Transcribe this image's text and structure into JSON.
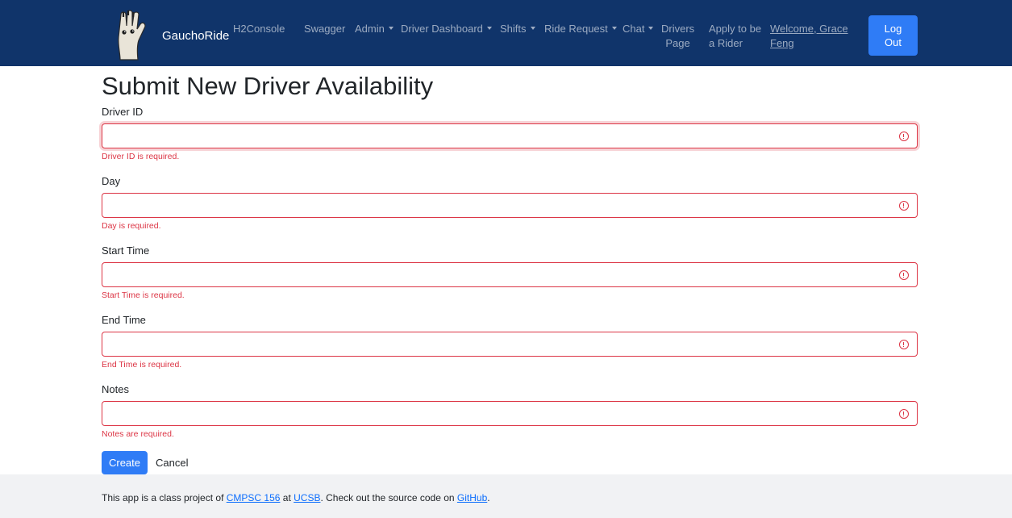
{
  "navbar": {
    "brand": "GauchoRide",
    "items": [
      {
        "label": "H2Console",
        "dropdown": false
      },
      {
        "label": "Swagger",
        "dropdown": false
      },
      {
        "label": "Admin",
        "dropdown": true
      },
      {
        "label": "Driver Dashboard",
        "dropdown": true
      },
      {
        "label": "Shifts",
        "dropdown": true
      },
      {
        "label": "Ride Request",
        "dropdown": true
      },
      {
        "label": "Chat",
        "dropdown": true
      }
    ],
    "drivers_page": {
      "line1": "Drivers",
      "line2": "Page"
    },
    "apply_rider": {
      "line1": "Apply to be",
      "line2": "a Rider"
    },
    "welcome": {
      "line1": "Welcome, Grace",
      "line2": "Feng"
    },
    "logout": {
      "line1": "Log",
      "line2": "Out"
    },
    "colors": {
      "background": "#10346a",
      "button": "#2f7cf6"
    }
  },
  "page": {
    "title": "Submit New Driver Availability"
  },
  "form": {
    "fields": [
      {
        "label": "Driver ID",
        "value": "",
        "error": "Driver ID is required."
      },
      {
        "label": "Day",
        "value": "",
        "error": "Day is required."
      },
      {
        "label": "Start Time",
        "value": "",
        "error": "Start Time is required."
      },
      {
        "label": "End Time",
        "value": "",
        "error": "End Time is required."
      },
      {
        "label": "Notes",
        "value": "",
        "error": "Notes are required."
      }
    ],
    "create_label": "Create",
    "cancel_label": "Cancel",
    "error_color": "#dc3545"
  },
  "footer": {
    "text_1": "This app is a class project of ",
    "link_1": "CMPSC 156",
    "text_2": " at ",
    "link_2": "UCSB",
    "text_3": ". Check out the source code on ",
    "link_3": "GitHub",
    "text_4": "."
  }
}
